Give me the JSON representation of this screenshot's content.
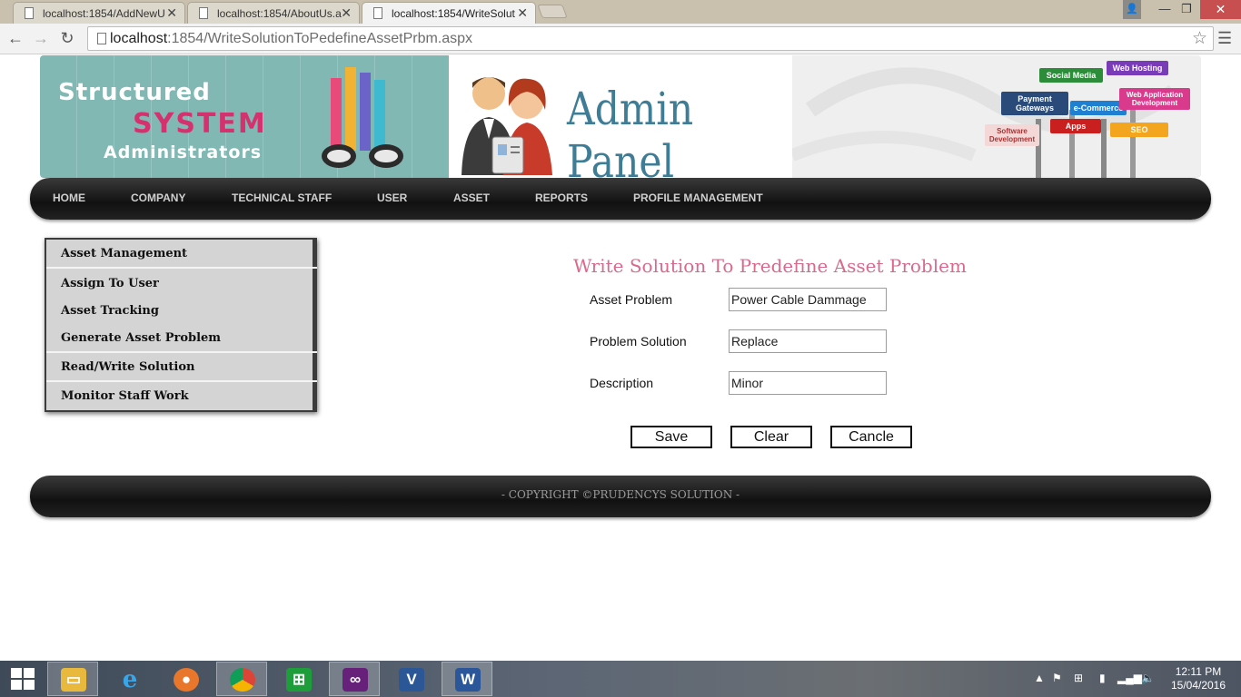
{
  "browser": {
    "tabs": [
      {
        "title": "localhost:1854/AddNewU"
      },
      {
        "title": "localhost:1854/AboutUs.a"
      },
      {
        "title": "localhost:1854/WriteSolut"
      }
    ],
    "url_host": "localhost",
    "url_rest": ":1854/WriteSolutionToPedefineAssetPrbm.aspx"
  },
  "banner": {
    "logo_line1": "Structured",
    "logo_line2": "SYSTEM",
    "logo_line3": "Administrators",
    "panel_title": "Admin Panel",
    "signs": [
      "Social Media",
      "Web Hosting",
      "Payment Gateways",
      "e-Commerce",
      "Web Application Development",
      "Software Development",
      "Apps",
      "SEO"
    ]
  },
  "nav": {
    "items": [
      "HOME",
      "COMPANY",
      "TECHNICAL STAFF",
      "USER",
      "ASSET",
      "REPORTS",
      "PROFILE MANAGEMENT"
    ]
  },
  "sidebar": {
    "items": [
      "Asset Management",
      "Assign To User",
      "Asset Tracking",
      "Generate Asset Problem",
      "Read/Write Solution",
      "Monitor Staff Work"
    ]
  },
  "form": {
    "title": "Write Solution To Predefine Asset Problem",
    "fields": [
      {
        "label": "Asset Problem",
        "value": "Power Cable Dammage"
      },
      {
        "label": "Problem Solution",
        "value": "Replace"
      },
      {
        "label": "Description",
        "value": "Minor"
      }
    ],
    "buttons": {
      "save": "Save",
      "clear": "Clear",
      "cancel": "Cancle"
    }
  },
  "footer": {
    "copyright": "- COPYRIGHT ©PRUDENCYS SOLUTION -"
  },
  "taskbar": {
    "time": "12:11 PM",
    "date": "15/04/2016"
  },
  "colors": {
    "form_title": "#d96a8c",
    "nav_bar": "#1c1c1c",
    "banner_left": "#82b8b3",
    "admin_title": "#3f7d97"
  }
}
